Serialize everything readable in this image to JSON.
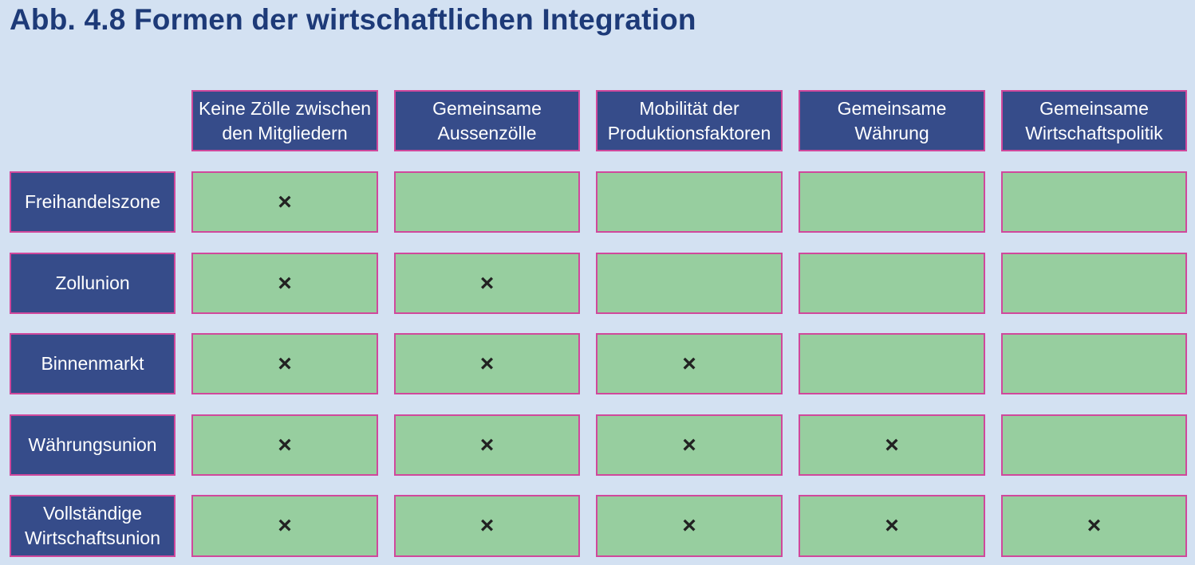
{
  "title": "Abb. 4.8  Formen der wirtschaftlichen Integration",
  "columns": [
    "Keine Zölle zwischen\nden Mitgliedern",
    "Gemeinsame\nAussenzölle",
    "Mobilität der\nProduktionsfaktoren",
    "Gemeinsame\nWährung",
    "Gemeinsame\nWirtschaftspolitik"
  ],
  "rows": [
    {
      "label": "Freihandelszone",
      "marks": [
        "×",
        "",
        "",
        "",
        ""
      ]
    },
    {
      "label": "Zollunion",
      "marks": [
        "×",
        "×",
        "",
        "",
        ""
      ]
    },
    {
      "label": "Binnenmarkt",
      "marks": [
        "×",
        "×",
        "×",
        "",
        ""
      ]
    },
    {
      "label": "Währungsunion",
      "marks": [
        "×",
        "×",
        "×",
        "×",
        ""
      ]
    },
    {
      "label": "Vollständige\nWirtschaftsunion",
      "marks": [
        "×",
        "×",
        "×",
        "×",
        "×"
      ]
    }
  ],
  "colors": {
    "background": "#d3e1f2",
    "header_fill": "#364c8a",
    "cell_fill": "#97ce9f",
    "border": "#d0489c",
    "title": "#1d3a78"
  }
}
